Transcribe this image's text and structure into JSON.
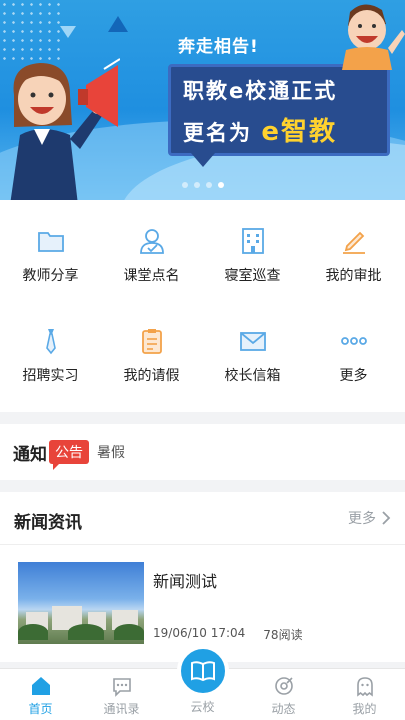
{
  "banner": {
    "slogan": "奔走相告!",
    "line1": "职教e校通正式",
    "line2_prefix": "更名为",
    "line2_accent": "e",
    "line2_suffix": "智教",
    "pages": 4,
    "active_page": 4
  },
  "grid": {
    "items": [
      {
        "label": "教师分享",
        "icon": "folder-icon"
      },
      {
        "label": "课堂点名",
        "icon": "user-check-icon"
      },
      {
        "label": "寝室巡查",
        "icon": "building-icon"
      },
      {
        "label": "我的审批",
        "icon": "pencil-icon"
      },
      {
        "label": "招聘实习",
        "icon": "tie-icon"
      },
      {
        "label": "我的请假",
        "icon": "clipboard-icon"
      },
      {
        "label": "校长信箱",
        "icon": "mail-icon"
      },
      {
        "label": "更多",
        "icon": "more-icon"
      }
    ]
  },
  "notice": {
    "title": "通知",
    "badge": "公告",
    "text": "暑假"
  },
  "news": {
    "header": "新闻资讯",
    "more_label": "更多",
    "items": [
      {
        "title": "新闻测试",
        "date": "19/06/10 17:04",
        "reads": "78阅读"
      }
    ]
  },
  "tabbar": {
    "tabs": [
      {
        "label": "首页",
        "icon": "home-icon",
        "active": true
      },
      {
        "label": "通讯录",
        "icon": "chat-icon",
        "active": false
      },
      {
        "label": "云校",
        "icon": "book-icon",
        "active": false
      },
      {
        "label": "动态",
        "icon": "target-icon",
        "active": false
      },
      {
        "label": "我的",
        "icon": "ghost-icon",
        "active": false
      }
    ]
  },
  "colors": {
    "accent": "#20a0e4",
    "badge_red": "#e8443a",
    "icon_blue": "#5aa9e6",
    "icon_orange": "#f3a24a"
  }
}
